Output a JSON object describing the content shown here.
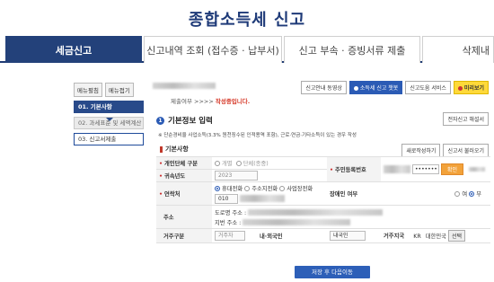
{
  "page": {
    "title": "종합소득세 신고"
  },
  "tabs": [
    {
      "label": "세금신고"
    },
    {
      "label": "신고내역 조회 (접수증 · 납부서)"
    },
    {
      "label": "신고 부속 · 증빙서류 제출"
    },
    {
      "label": "삭제내"
    }
  ],
  "sidebar": {
    "menu_expand": "메뉴펼침",
    "menu_collapse": "메뉴접기",
    "items": [
      {
        "label": "01. 기본사항"
      },
      {
        "label": "02. 과세표준 및 세액계산"
      },
      {
        "label": "03. 신고서제출"
      }
    ]
  },
  "info": {
    "status_label": "제출여부",
    "status_arrows": ">>>>",
    "status_value": "작성중입니다."
  },
  "top_buttons": {
    "video": "신고안내 동영상",
    "chatbot": "소득세 신고 챗봇",
    "help_service": "신고도움 서비스",
    "preview": "미리보기"
  },
  "section": {
    "num": "1",
    "title": "기본정보 입력",
    "help_button": "전자신고 해설서",
    "note": "※ 단순경비율 사업소득(3.3% 원천징수된 인적용역 포함), 근로·연금·기타소득이 있는 경우 작성"
  },
  "basic": {
    "title": "기본사항",
    "new_button": "새로작성하기",
    "load_button": "신고서 불러오기"
  },
  "form": {
    "type_label": "개인단체 구분",
    "type_opt1": "개별",
    "type_opt2": "단체(종중)",
    "rrn_label": "주민등록번호",
    "rrn_mask": "•••••••",
    "rrn_button": "확인",
    "year_label": "귀속년도",
    "year_value": "2023",
    "contact_label": "연락처",
    "phone_opt1": "휴대전화",
    "phone_opt2": "주소지전화",
    "phone_opt3": "사업장전화",
    "phone_prefix": "010",
    "disabled_label": "장애인 여부",
    "disabled_yes": "여",
    "disabled_no": "부",
    "address_label": "주소",
    "road_address_label": "도로명 주소 :",
    "lot_address_label": "지번 주소 :",
    "residence_label": "거주구분",
    "residence_value": "거주자",
    "nationality_label": "내·외국인",
    "nationality_value": "내국인",
    "country_label": "거주지국",
    "country_code": "KR",
    "country_name": "대한민국",
    "country_button": "선택"
  },
  "actions": {
    "save_next": "저장 후 다음이동"
  }
}
